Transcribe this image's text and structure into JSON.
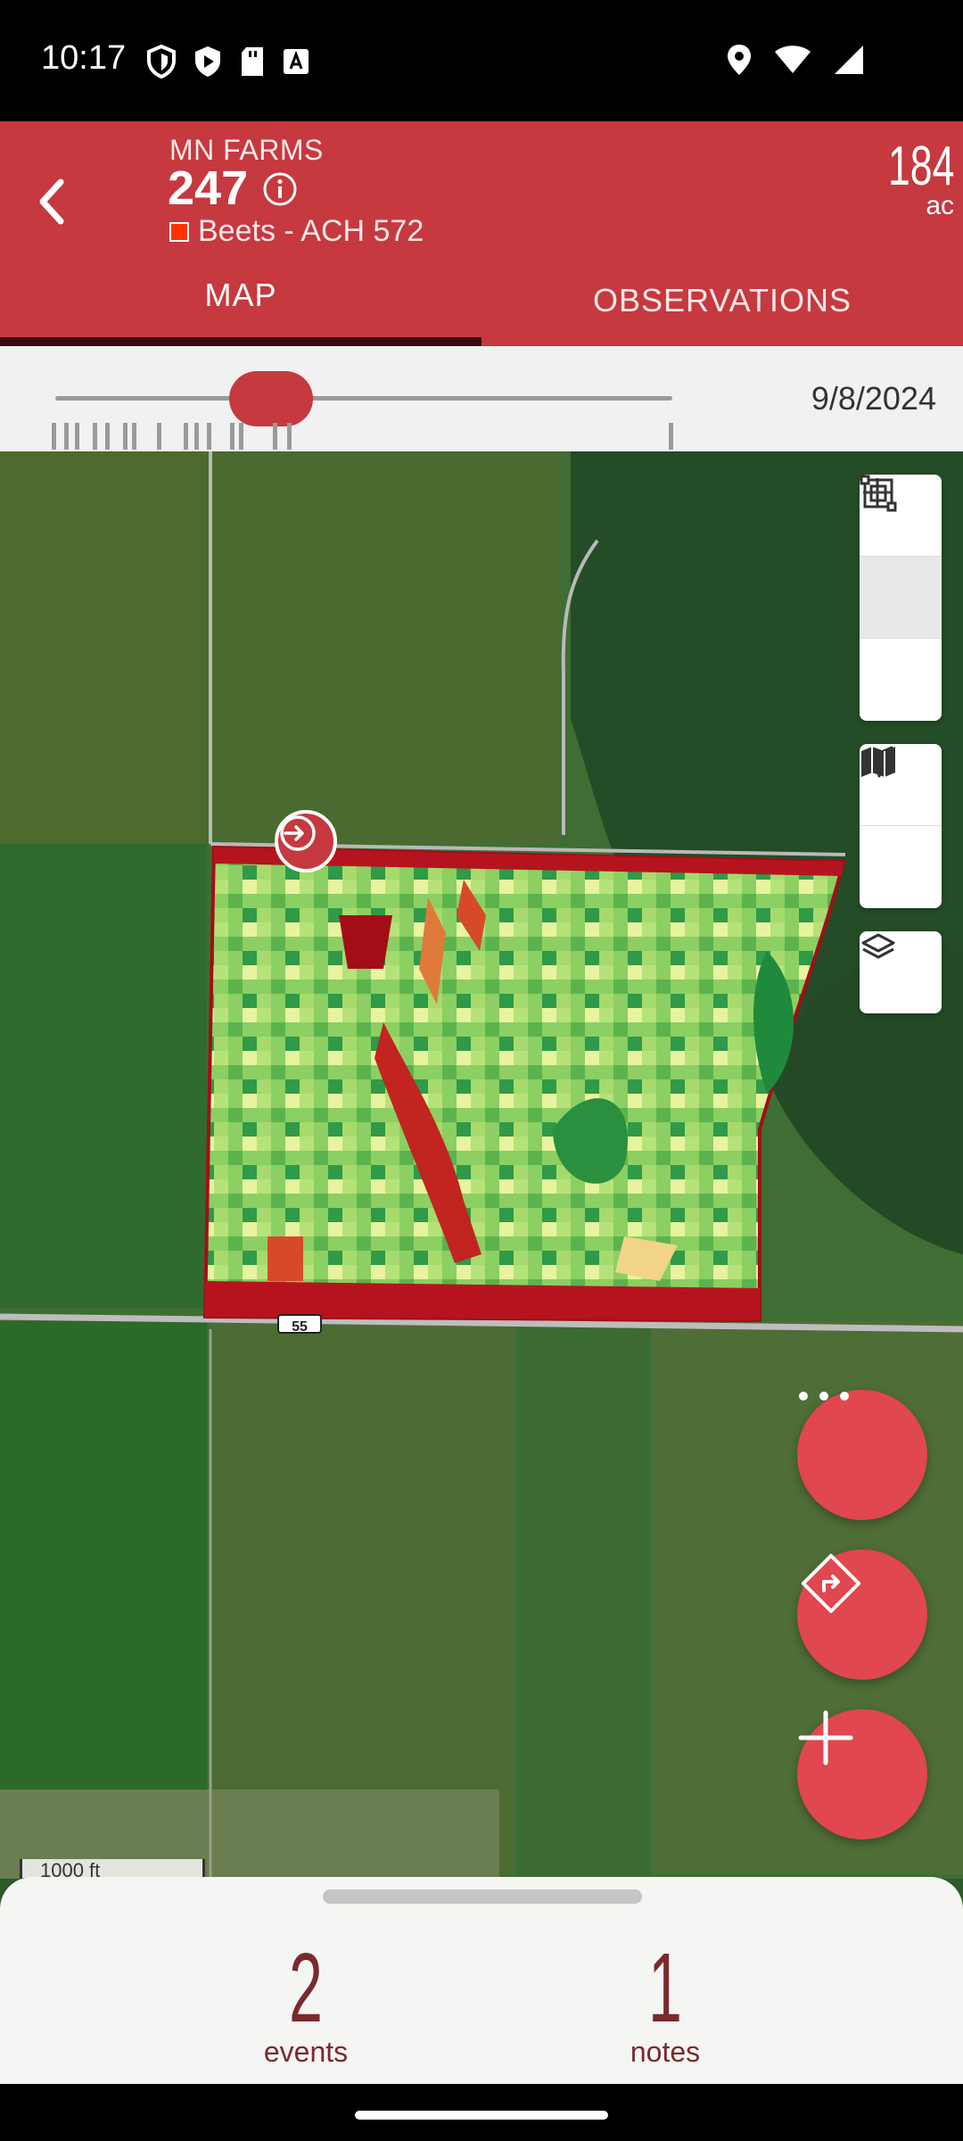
{
  "status_bar": {
    "time": "10:17"
  },
  "header": {
    "farm": "MN FARMS",
    "field": "247",
    "crop": "Beets - ACH 572",
    "acres_value": "184",
    "acres_unit": "ac",
    "crop_color": "#ff3300",
    "accent_color": "#c5393f"
  },
  "tabs": [
    {
      "label": "MAP",
      "active": true
    },
    {
      "label": "OBSERVATIONS",
      "active": false
    }
  ],
  "timeline": {
    "date": "9/8/2024",
    "position_fraction": 0.35
  },
  "map": {
    "scale": "1000 ft",
    "road_shield": "55",
    "controls": [
      "plus-icon",
      "minus-icon",
      "fit-bounds-icon",
      "locate-icon",
      "map-icon",
      "layers-icon"
    ],
    "fabs": [
      "more-icon",
      "directions-icon",
      "add-icon"
    ]
  },
  "summary": {
    "events_count": "2",
    "events_label": "events",
    "notes_count": "1",
    "notes_label": "notes"
  }
}
